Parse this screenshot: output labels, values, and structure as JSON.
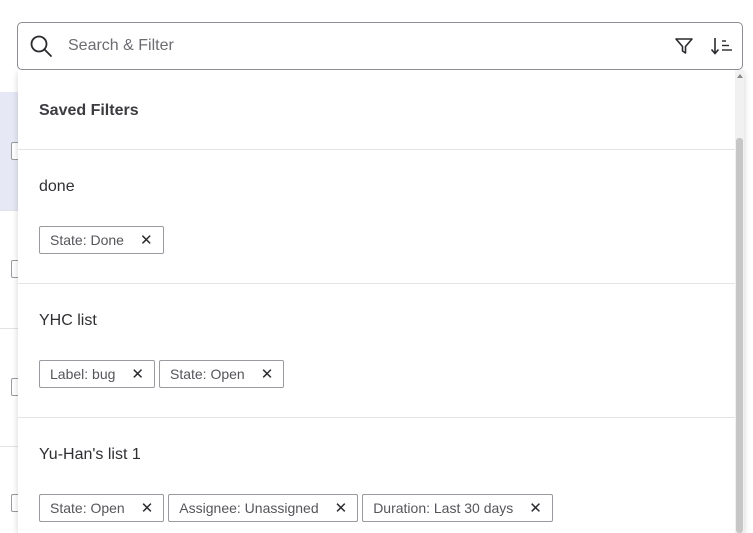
{
  "search": {
    "placeholder": "Search & Filter"
  },
  "saved_filters": {
    "title": "Saved Filters",
    "items": [
      {
        "name": "done",
        "chips": [
          "State: Done"
        ]
      },
      {
        "name": "YHC list",
        "chips": [
          "Label: bug",
          "State: Open"
        ]
      },
      {
        "name": "Yu-Han's list 1",
        "chips": [
          "State: Open",
          "Assignee: Unassigned",
          "Duration: Last 30 days"
        ]
      }
    ]
  },
  "icons": {
    "search": "search-icon",
    "filter": "funnel-icon",
    "sort": "sort-descending-icon",
    "chip_remove": "close-icon"
  },
  "colors": {
    "border": "#8d8d93",
    "chip_border": "#9a9aa0",
    "selected_row_bg": "#e6e9f5",
    "text": "#2f2f33"
  }
}
